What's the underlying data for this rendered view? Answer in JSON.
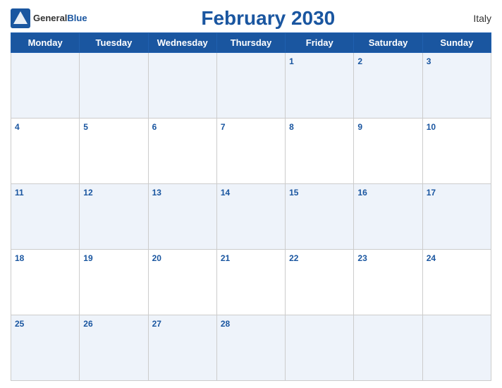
{
  "header": {
    "title": "February 2030",
    "country": "Italy",
    "logo": {
      "general": "General",
      "blue": "Blue"
    }
  },
  "weekdays": [
    "Monday",
    "Tuesday",
    "Wednesday",
    "Thursday",
    "Friday",
    "Saturday",
    "Sunday"
  ],
  "weeks": [
    [
      null,
      null,
      null,
      null,
      1,
      2,
      3
    ],
    [
      4,
      5,
      6,
      7,
      8,
      9,
      10
    ],
    [
      11,
      12,
      13,
      14,
      15,
      16,
      17
    ],
    [
      18,
      19,
      20,
      21,
      22,
      23,
      24
    ],
    [
      25,
      26,
      27,
      28,
      null,
      null,
      null
    ]
  ]
}
